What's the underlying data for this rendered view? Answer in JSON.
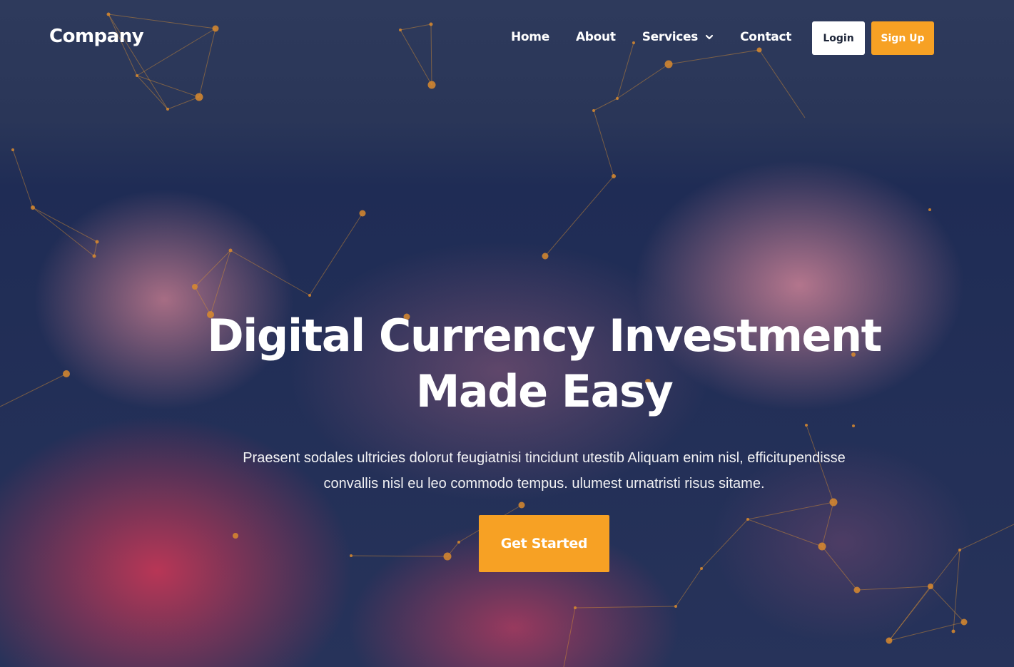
{
  "brand": {
    "name": "Company"
  },
  "nav": {
    "items": [
      {
        "label": "Home"
      },
      {
        "label": "About"
      },
      {
        "label": "Services",
        "icon": "chevron-down-icon"
      },
      {
        "label": "Contact"
      }
    ],
    "login_label": "Login",
    "signup_label": "Sign Up"
  },
  "hero": {
    "title_line1": "Digital Currency Investment",
    "title_line2": "Made Easy",
    "desc_line1": "Praesent sodales ultricies dolorut feugiatnisi tincidunt utestib Aliquam enim nisl, efficitupendisse",
    "desc_line2": "convallis nisl eu leo commodo tempus. ulumest urnatristi risus sitame.",
    "cta_label": "Get Started"
  },
  "colors": {
    "accent": "#f7a124",
    "background": "#253252",
    "network_lines": "#d98a2e"
  }
}
